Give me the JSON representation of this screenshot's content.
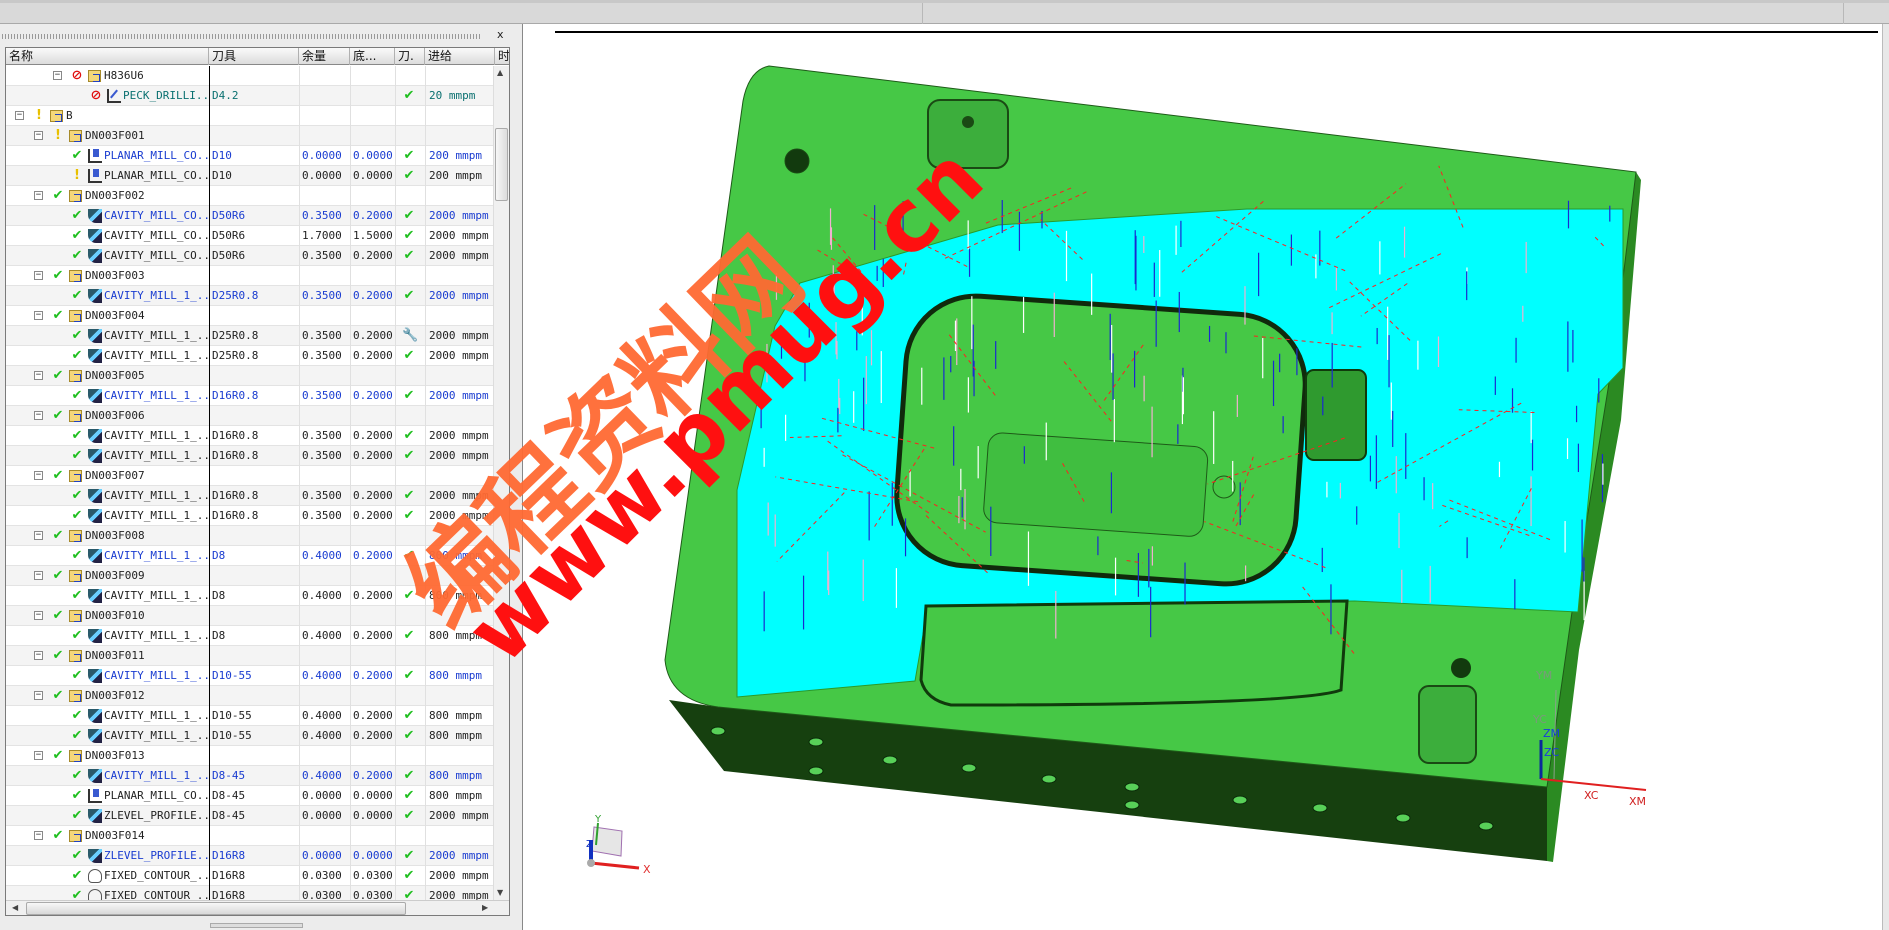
{
  "panel": {
    "close_label": "x"
  },
  "columns": [
    "名称",
    "刀具",
    "余量",
    "底...",
    "刀.",
    "进给",
    "时"
  ],
  "rows": [
    {
      "level": 2,
      "kind": "group",
      "status": "noentry",
      "name": "H836U6"
    },
    {
      "level": 3,
      "kind": "op",
      "op": "drill",
      "status": "noentry",
      "name": "PECK_DRILLI...",
      "tool": "D4.2",
      "stock": "",
      "floor": "",
      "path": "check",
      "feed": "20 mmpm",
      "color": "teal"
    },
    {
      "level": 0,
      "kind": "group",
      "status": "bulb",
      "name": "B"
    },
    {
      "level": 1,
      "kind": "group",
      "status": "bulb",
      "name": "DN003F001"
    },
    {
      "level": 2,
      "kind": "op",
      "op": "planar",
      "status": "check",
      "name": "PLANAR_MILL_CO...",
      "tool": "D10",
      "stock": "0.0000",
      "floor": "0.0000",
      "path": "check",
      "feed": "200 mmpm",
      "color": "blue"
    },
    {
      "level": 2,
      "kind": "op",
      "op": "planar",
      "status": "bulb",
      "name": "PLANAR_MILL_CO...",
      "tool": "D10",
      "stock": "0.0000",
      "floor": "0.0000",
      "path": "check",
      "feed": "200 mmpm",
      "color": "black"
    },
    {
      "level": 1,
      "kind": "group",
      "status": "check",
      "name": "DN003F002"
    },
    {
      "level": 2,
      "kind": "op",
      "op": "cavity",
      "status": "check",
      "name": "CAVITY_MILL_CO...",
      "tool": "D50R6",
      "stock": "0.3500",
      "floor": "0.2000",
      "path": "check",
      "feed": "2000 mmpm",
      "color": "blue"
    },
    {
      "level": 2,
      "kind": "op",
      "op": "cavity",
      "status": "check",
      "name": "CAVITY_MILL_CO...",
      "tool": "D50R6",
      "stock": "1.7000",
      "floor": "1.5000",
      "path": "check",
      "feed": "2000 mmpm",
      "color": "black"
    },
    {
      "level": 2,
      "kind": "op",
      "op": "cavity",
      "status": "check",
      "name": "CAVITY_MILL_CO...",
      "tool": "D50R6",
      "stock": "0.3500",
      "floor": "0.2000",
      "path": "check",
      "feed": "2000 mmpm",
      "color": "black"
    },
    {
      "level": 1,
      "kind": "group",
      "status": "check",
      "name": "DN003F003"
    },
    {
      "level": 2,
      "kind": "op",
      "op": "cavity",
      "status": "check",
      "name": "CAVITY_MILL_1_...",
      "tool": "D25R0.8",
      "stock": "0.3500",
      "floor": "0.2000",
      "path": "check",
      "feed": "2000 mmpm",
      "color": "blue"
    },
    {
      "level": 1,
      "kind": "group",
      "status": "check",
      "name": "DN003F004"
    },
    {
      "level": 2,
      "kind": "op",
      "op": "cavity",
      "status": "check",
      "name": "CAVITY_MILL_1_...",
      "tool": "D25R0.8",
      "stock": "0.3500",
      "floor": "0.2000",
      "path": "wrench",
      "feed": "2000 mmpm",
      "color": "black"
    },
    {
      "level": 2,
      "kind": "op",
      "op": "cavity",
      "status": "check",
      "name": "CAVITY_MILL_1_...",
      "tool": "D25R0.8",
      "stock": "0.3500",
      "floor": "0.2000",
      "path": "check",
      "feed": "2000 mmpm",
      "color": "black"
    },
    {
      "level": 1,
      "kind": "group",
      "status": "check",
      "name": "DN003F005"
    },
    {
      "level": 2,
      "kind": "op",
      "op": "cavity",
      "status": "check",
      "name": "CAVITY_MILL_1_...",
      "tool": "D16R0.8",
      "stock": "0.3500",
      "floor": "0.2000",
      "path": "check",
      "feed": "2000 mmpm",
      "color": "blue"
    },
    {
      "level": 1,
      "kind": "group",
      "status": "check",
      "name": "DN003F006"
    },
    {
      "level": 2,
      "kind": "op",
      "op": "cavity",
      "status": "check",
      "name": "CAVITY_MILL_1_...",
      "tool": "D16R0.8",
      "stock": "0.3500",
      "floor": "0.2000",
      "path": "check",
      "feed": "2000 mmpm",
      "color": "black"
    },
    {
      "level": 2,
      "kind": "op",
      "op": "cavity",
      "status": "check",
      "name": "CAVITY_MILL_1_...",
      "tool": "D16R0.8",
      "stock": "0.3500",
      "floor": "0.2000",
      "path": "check",
      "feed": "2000 mmpm",
      "color": "black"
    },
    {
      "level": 1,
      "kind": "group",
      "status": "check",
      "name": "DN003F007"
    },
    {
      "level": 2,
      "kind": "op",
      "op": "cavity",
      "status": "check",
      "name": "CAVITY_MILL_1_...",
      "tool": "D16R0.8",
      "stock": "0.3500",
      "floor": "0.2000",
      "path": "check",
      "feed": "2000 mmpm",
      "color": "black"
    },
    {
      "level": 2,
      "kind": "op",
      "op": "cavity",
      "status": "check",
      "name": "CAVITY_MILL_1_...",
      "tool": "D16R0.8",
      "stock": "0.3500",
      "floor": "0.2000",
      "path": "check",
      "feed": "2000 mmpm",
      "color": "black"
    },
    {
      "level": 1,
      "kind": "group",
      "status": "check",
      "name": "DN003F008"
    },
    {
      "level": 2,
      "kind": "op",
      "op": "cavity",
      "status": "check",
      "name": "CAVITY_MILL_1_...",
      "tool": "D8",
      "stock": "0.4000",
      "floor": "0.2000",
      "path": "check",
      "feed": "800 mmpm",
      "color": "blue"
    },
    {
      "level": 1,
      "kind": "group",
      "status": "check",
      "name": "DN003F009"
    },
    {
      "level": 2,
      "kind": "op",
      "op": "cavity",
      "status": "check",
      "name": "CAVITY_MILL_1_...",
      "tool": "D8",
      "stock": "0.4000",
      "floor": "0.2000",
      "path": "check",
      "feed": "800 mmpm",
      "color": "black"
    },
    {
      "level": 1,
      "kind": "group",
      "status": "check",
      "name": "DN003F010"
    },
    {
      "level": 2,
      "kind": "op",
      "op": "cavity",
      "status": "check",
      "name": "CAVITY_MILL_1_...",
      "tool": "D8",
      "stock": "0.4000",
      "floor": "0.2000",
      "path": "check",
      "feed": "800 mmpm",
      "color": "black"
    },
    {
      "level": 1,
      "kind": "group",
      "status": "check",
      "name": "DN003F011"
    },
    {
      "level": 2,
      "kind": "op",
      "op": "cavity",
      "status": "check",
      "name": "CAVITY_MILL_1_...",
      "tool": "D10-55",
      "stock": "0.4000",
      "floor": "0.2000",
      "path": "check",
      "feed": "800 mmpm",
      "color": "blue"
    },
    {
      "level": 1,
      "kind": "group",
      "status": "check",
      "name": "DN003F012"
    },
    {
      "level": 2,
      "kind": "op",
      "op": "cavity",
      "status": "check",
      "name": "CAVITY_MILL_1_...",
      "tool": "D10-55",
      "stock": "0.4000",
      "floor": "0.2000",
      "path": "check",
      "feed": "800 mmpm",
      "color": "black"
    },
    {
      "level": 2,
      "kind": "op",
      "op": "cavity",
      "status": "check",
      "name": "CAVITY_MILL_1_...",
      "tool": "D10-55",
      "stock": "0.4000",
      "floor": "0.2000",
      "path": "check",
      "feed": "800 mmpm",
      "color": "black"
    },
    {
      "level": 1,
      "kind": "group",
      "status": "check",
      "name": "DN003F013"
    },
    {
      "level": 2,
      "kind": "op",
      "op": "cavity",
      "status": "check",
      "name": "CAVITY_MILL_1_...",
      "tool": "D8-45",
      "stock": "0.4000",
      "floor": "0.2000",
      "path": "check",
      "feed": "800 mmpm",
      "color": "blue"
    },
    {
      "level": 2,
      "kind": "op",
      "op": "planar",
      "status": "check",
      "name": "PLANAR_MILL_CO...",
      "tool": "D8-45",
      "stock": "0.0000",
      "floor": "0.0000",
      "path": "check",
      "feed": "800 mmpm",
      "color": "black"
    },
    {
      "level": 2,
      "kind": "op",
      "op": "cavity",
      "status": "check",
      "name": "ZLEVEL_PROFILE...",
      "tool": "D8-45",
      "stock": "0.0000",
      "floor": "0.0000",
      "path": "check",
      "feed": "2000 mmpm",
      "color": "black"
    },
    {
      "level": 1,
      "kind": "group",
      "status": "check",
      "name": "DN003F014"
    },
    {
      "level": 2,
      "kind": "op",
      "op": "cavity",
      "status": "check",
      "name": "ZLEVEL_PROFILE...",
      "tool": "D16R8",
      "stock": "0.0000",
      "floor": "0.0000",
      "path": "check",
      "feed": "2000 mmpm",
      "color": "blue"
    },
    {
      "level": 2,
      "kind": "op",
      "op": "fixed",
      "status": "check",
      "name": "FIXED_CONTOUR_...",
      "tool": "D16R8",
      "stock": "0.0300",
      "floor": "0.0300",
      "path": "check",
      "feed": "2000 mmpm",
      "color": "black"
    },
    {
      "level": 2,
      "kind": "op",
      "op": "fixed",
      "status": "check",
      "name": "FIXED_CONTOUR_...",
      "tool": "D16R8",
      "stock": "0.0300",
      "floor": "0.0300",
      "path": "check",
      "feed": "2000 mmpm",
      "color": "black"
    }
  ],
  "viewport": {
    "colors": {
      "part": "#44c844",
      "machined": "#00ffff",
      "side": "#16400f",
      "toolpath_red": "#ff2020",
      "toolpath_blue": "#1a2ad0"
    },
    "wcs_labels": {
      "ym": "YM",
      "yc": "YC",
      "zm": "ZM",
      "zc": "ZC",
      "xc": "XC",
      "xm": "XM"
    },
    "triad_labels": {
      "x": "X",
      "y": "Y",
      "z": "Z"
    },
    "watermark": {
      "cn": "编程资料网",
      "url": "www.pmug.cn"
    }
  }
}
